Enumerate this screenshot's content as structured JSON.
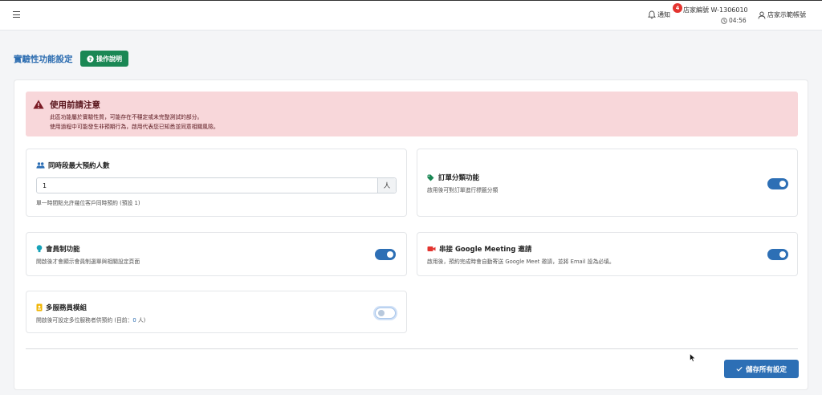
{
  "header": {
    "notif_label": "通知",
    "notif_count": "4",
    "store_id": "店家編號 W-1306010",
    "time": "04:56",
    "account_label": "店家示範帳號"
  },
  "page": {
    "title": "實驗性功能設定",
    "help_label": "操作說明"
  },
  "alert": {
    "title": "使用前請注意",
    "line1": "此區功能屬於實驗性質，可能存在不穩定或未完整測試的部分。",
    "line2": "使用過程中可能發生非預期行為，啟用代表您已知悉並同意相關風險。"
  },
  "settings": {
    "max_booking": {
      "title": "同時段最大預約人數",
      "value": "1",
      "unit": "人",
      "desc": "單一時間點允許幾位客戶同時預約 (預設 1)"
    },
    "order_category": {
      "title": "訂單分類功能",
      "desc": "啟用後可對訂單進行標籤分類",
      "enabled": true
    },
    "membership": {
      "title": "會員制功能",
      "desc": "開啟後才會顯示會員制選單與相關設定頁面",
      "enabled": true
    },
    "google_meeting": {
      "title": "串接 Google Meeting 邀請",
      "desc": "啟用後，預約完成時會自動寄送 Google Meet 邀請，並將 Email 設為必填。",
      "enabled": true
    },
    "multi_staff": {
      "title": "多服務員模組",
      "desc_prefix": "開啟後可設定多位服務者供預約 (目前：",
      "desc_count": "0",
      "desc_suffix": " 人)",
      "enabled": false
    }
  },
  "footer": {
    "save_label": "儲存所有設定"
  },
  "colors": {
    "primary": "#2d6fb5",
    "success": "#1a8754",
    "danger_bg": "#f8d7da",
    "danger_text": "#58151c",
    "badge": "#e3342f"
  },
  "icons": {
    "menu": "hamburger-icon",
    "notif": "bell-icon",
    "clock": "clock-icon",
    "account": "user-icon",
    "help": "question-circle-icon",
    "alert": "warning-triangle-icon",
    "max_booking": "users-icon",
    "order_category": "tags-icon",
    "membership": "lightbulb-icon",
    "google_meeting": "video-camera-icon",
    "multi_staff": "id-badge-icon",
    "save": "check-icon"
  }
}
